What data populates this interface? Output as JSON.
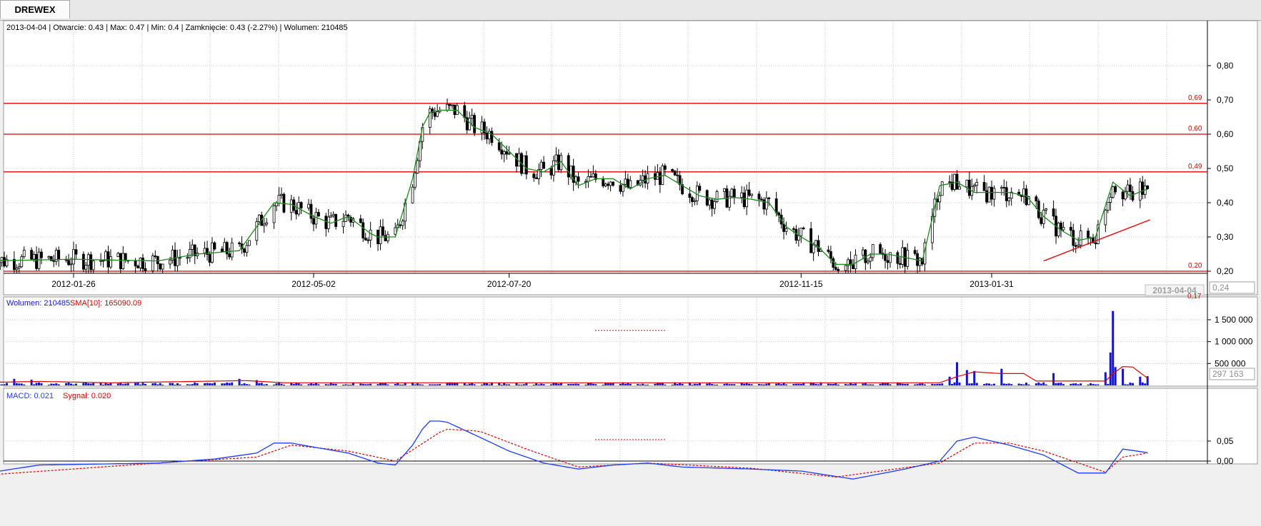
{
  "tab_label": "DREWEX",
  "colors": {
    "sma_line": "#1a8a1a",
    "levels": "#e00000",
    "volume_bars": "#1515d0",
    "volume_sma": "#e00000",
    "macd": "#1e3cff",
    "signal": "#e00000"
  },
  "chart_data": [
    {
      "type": "candlestick",
      "info_line": "2013-04-04 | Otwarcie: 0.43 | Max: 0.47 | Min: 0.4 | Zamknięcie: 0.43 (-2.27%) | Wolumen: 210485",
      "x_ticks": [
        "2012-01-26",
        "2012-05-02",
        "2012-07-20",
        "2012-11-15",
        "2013-01-31"
      ],
      "current_date_label": "2013-04-04",
      "y_ticks": [
        "0,20",
        "0,30",
        "0,40",
        "0,50",
        "0,60",
        "0,70",
        "0,80"
      ],
      "ylim": [
        0.19,
        0.85
      ],
      "horizontal_levels": [
        {
          "value": 0.69,
          "label": "0,69"
        },
        {
          "value": 0.6,
          "label": "0,60"
        },
        {
          "value": 0.49,
          "label": "0,49"
        },
        {
          "value": 0.2,
          "label": "0,20"
        }
      ],
      "bottom_label": "0,17",
      "last_value_label": "0,24",
      "trend_line": {
        "from": {
          "date": "2013-02-21",
          "value": 0.23
        },
        "to": {
          "date": "2013-04-05",
          "value": 0.35
        }
      },
      "sma_waypoints": [
        {
          "date": "2011-12-22",
          "value": 0.23
        },
        {
          "date": "2012-01-26",
          "value": 0.235
        },
        {
          "date": "2012-02-29",
          "value": 0.23
        },
        {
          "date": "2012-03-16",
          "value": 0.25
        },
        {
          "date": "2012-04-02",
          "value": 0.26
        },
        {
          "date": "2012-04-09",
          "value": 0.33
        },
        {
          "date": "2012-04-16",
          "value": 0.4
        },
        {
          "date": "2012-04-23",
          "value": 0.395
        },
        {
          "date": "2012-05-02",
          "value": 0.36
        },
        {
          "date": "2012-05-09",
          "value": 0.34
        },
        {
          "date": "2012-05-16",
          "value": 0.36
        },
        {
          "date": "2012-05-25",
          "value": 0.31
        },
        {
          "date": "2012-05-28",
          "value": 0.3
        },
        {
          "date": "2012-06-04",
          "value": 0.3
        },
        {
          "date": "2012-06-11",
          "value": 0.47
        },
        {
          "date": "2012-06-16",
          "value": 0.66
        },
        {
          "date": "2012-06-22",
          "value": 0.67
        },
        {
          "date": "2012-06-29",
          "value": 0.67
        },
        {
          "date": "2012-07-06",
          "value": 0.62
        },
        {
          "date": "2012-07-13",
          "value": 0.6
        },
        {
          "date": "2012-07-20",
          "value": 0.55
        },
        {
          "date": "2012-07-27",
          "value": 0.5
        },
        {
          "date": "2012-08-03",
          "value": 0.49
        },
        {
          "date": "2012-08-10",
          "value": 0.52
        },
        {
          "date": "2012-08-17",
          "value": 0.45
        },
        {
          "date": "2012-08-24",
          "value": 0.47
        },
        {
          "date": "2012-08-31",
          "value": 0.47
        },
        {
          "date": "2012-09-07",
          "value": 0.44
        },
        {
          "date": "2012-09-14",
          "value": 0.47
        },
        {
          "date": "2012-09-21",
          "value": 0.48
        },
        {
          "date": "2012-09-28",
          "value": 0.45
        },
        {
          "date": "2012-10-05",
          "value": 0.42
        },
        {
          "date": "2012-10-12",
          "value": 0.41
        },
        {
          "date": "2012-10-19",
          "value": 0.415
        },
        {
          "date": "2012-10-26",
          "value": 0.41
        },
        {
          "date": "2012-11-02",
          "value": 0.4
        },
        {
          "date": "2012-11-09",
          "value": 0.33
        },
        {
          "date": "2012-11-15",
          "value": 0.3
        },
        {
          "date": "2012-11-22",
          "value": 0.27
        },
        {
          "date": "2012-11-29",
          "value": 0.22
        },
        {
          "date": "2012-12-06",
          "value": 0.22
        },
        {
          "date": "2012-12-13",
          "value": 0.25
        },
        {
          "date": "2012-12-20",
          "value": 0.25
        },
        {
          "date": "2012-12-27",
          "value": 0.24
        },
        {
          "date": "2013-01-03",
          "value": 0.23
        },
        {
          "date": "2013-01-10",
          "value": 0.45
        },
        {
          "date": "2013-01-17",
          "value": 0.46
        },
        {
          "date": "2013-01-24",
          "value": 0.43
        },
        {
          "date": "2013-01-31",
          "value": 0.43
        },
        {
          "date": "2013-02-07",
          "value": 0.43
        },
        {
          "date": "2013-02-14",
          "value": 0.42
        },
        {
          "date": "2013-02-21",
          "value": 0.36
        },
        {
          "date": "2013-02-28",
          "value": 0.32
        },
        {
          "date": "2013-03-07",
          "value": 0.29
        },
        {
          "date": "2013-03-14",
          "value": 0.3
        },
        {
          "date": "2013-03-21",
          "value": 0.46
        },
        {
          "date": "2013-03-28",
          "value": 0.42
        },
        {
          "date": "2013-04-04",
          "value": 0.44
        }
      ]
    },
    {
      "type": "bar",
      "title_volume": "Wolumen: 210485",
      "title_sma": "SMA[10]: 165090.09",
      "y_ticks": [
        "500 000",
        "1 000 000",
        "1 500 000"
      ],
      "ylim": [
        0,
        1750000
      ],
      "last_value_label": "297 163",
      "spikes": [
        {
          "date": "2012-01-02",
          "value": 150000
        },
        {
          "date": "2012-01-09",
          "value": 130000
        },
        {
          "date": "2012-04-02",
          "value": 150000
        },
        {
          "date": "2012-04-09",
          "value": 120000
        },
        {
          "date": "2013-01-14",
          "value": 200000
        },
        {
          "date": "2013-01-17",
          "value": 530000
        },
        {
          "date": "2013-01-21",
          "value": 350000
        },
        {
          "date": "2013-01-24",
          "value": 330000
        },
        {
          "date": "2013-02-04",
          "value": 380000
        },
        {
          "date": "2013-02-25",
          "value": 280000
        },
        {
          "date": "2013-03-18",
          "value": 300000
        },
        {
          "date": "2013-03-20",
          "value": 750000
        },
        {
          "date": "2013-03-21",
          "value": 1700000
        },
        {
          "date": "2013-03-22",
          "value": 420000
        },
        {
          "date": "2013-03-25",
          "value": 380000
        },
        {
          "date": "2013-04-01",
          "value": 200000
        },
        {
          "date": "2013-04-04",
          "value": 210485
        }
      ],
      "sma_waypoints": [
        {
          "date": "2011-12-22",
          "value": 70000
        },
        {
          "date": "2012-01-13",
          "value": 90000
        },
        {
          "date": "2012-02-10",
          "value": 60000
        },
        {
          "date": "2012-04-05",
          "value": 110000
        },
        {
          "date": "2012-04-20",
          "value": 60000
        },
        {
          "date": "2013-01-10",
          "value": 60000
        },
        {
          "date": "2013-01-17",
          "value": 200000
        },
        {
          "date": "2013-01-24",
          "value": 310000
        },
        {
          "date": "2013-02-04",
          "value": 270000
        },
        {
          "date": "2013-02-13",
          "value": 270000
        },
        {
          "date": "2013-02-18",
          "value": 100000
        },
        {
          "date": "2013-03-18",
          "value": 100000
        },
        {
          "date": "2013-03-21",
          "value": 270000
        },
        {
          "date": "2013-03-25",
          "value": 430000
        },
        {
          "date": "2013-03-29",
          "value": 420000
        },
        {
          "date": "2013-04-04",
          "value": 165090
        }
      ]
    },
    {
      "type": "line",
      "title_macd": "MACD: 0.021",
      "title_signal": "Sygnał: 0.020",
      "y_ticks": [
        "0,00",
        "0,05"
      ],
      "ylim": [
        -0.05,
        0.11
      ],
      "macd_waypoints": [
        {
          "date": "2011-12-22",
          "value": -0.03
        },
        {
          "date": "2012-01-12",
          "value": -0.01
        },
        {
          "date": "2012-02-29",
          "value": -0.005
        },
        {
          "date": "2012-03-23",
          "value": 0.005
        },
        {
          "date": "2012-04-09",
          "value": 0.02
        },
        {
          "date": "2012-04-16",
          "value": 0.045
        },
        {
          "date": "2012-04-23",
          "value": 0.045
        },
        {
          "date": "2012-05-02",
          "value": 0.035
        },
        {
          "date": "2012-05-16",
          "value": 0.02
        },
        {
          "date": "2012-05-28",
          "value": -0.005
        },
        {
          "date": "2012-06-04",
          "value": -0.01
        },
        {
          "date": "2012-06-11",
          "value": 0.04
        },
        {
          "date": "2012-06-17",
          "value": 0.1
        },
        {
          "date": "2012-06-24",
          "value": 0.1
        },
        {
          "date": "2012-07-01",
          "value": 0.08
        },
        {
          "date": "2012-07-08",
          "value": 0.06
        },
        {
          "date": "2012-07-20",
          "value": 0.025
        },
        {
          "date": "2012-08-03",
          "value": -0.005
        },
        {
          "date": "2012-08-17",
          "value": -0.02
        },
        {
          "date": "2012-08-31",
          "value": -0.01
        },
        {
          "date": "2012-09-14",
          "value": -0.005
        },
        {
          "date": "2012-09-28",
          "value": -0.015
        },
        {
          "date": "2012-10-26",
          "value": -0.02
        },
        {
          "date": "2012-11-15",
          "value": -0.025
        },
        {
          "date": "2012-12-06",
          "value": -0.045
        },
        {
          "date": "2012-12-27",
          "value": -0.02
        },
        {
          "date": "2013-01-10",
          "value": 0.0
        },
        {
          "date": "2013-01-17",
          "value": 0.05
        },
        {
          "date": "2013-01-24",
          "value": 0.06
        },
        {
          "date": "2013-02-07",
          "value": 0.04
        },
        {
          "date": "2013-02-21",
          "value": 0.015
        },
        {
          "date": "2013-03-07",
          "value": -0.03
        },
        {
          "date": "2013-03-18",
          "value": -0.03
        },
        {
          "date": "2013-03-25",
          "value": 0.03
        },
        {
          "date": "2013-04-04",
          "value": 0.021
        }
      ],
      "signal_waypoints": [
        {
          "date": "2011-12-22",
          "value": -0.035
        },
        {
          "date": "2012-02-29",
          "value": -0.005
        },
        {
          "date": "2012-04-09",
          "value": 0.01
        },
        {
          "date": "2012-04-23",
          "value": 0.04
        },
        {
          "date": "2012-05-16",
          "value": 0.025
        },
        {
          "date": "2012-06-04",
          "value": 0.0
        },
        {
          "date": "2012-06-24",
          "value": 0.08
        },
        {
          "date": "2012-07-08",
          "value": 0.075
        },
        {
          "date": "2012-07-27",
          "value": 0.03
        },
        {
          "date": "2012-08-17",
          "value": -0.015
        },
        {
          "date": "2012-09-14",
          "value": -0.005
        },
        {
          "date": "2012-10-26",
          "value": -0.018
        },
        {
          "date": "2012-11-29",
          "value": -0.04
        },
        {
          "date": "2013-01-10",
          "value": -0.005
        },
        {
          "date": "2013-01-24",
          "value": 0.045
        },
        {
          "date": "2013-02-07",
          "value": 0.045
        },
        {
          "date": "2013-02-21",
          "value": 0.025
        },
        {
          "date": "2013-03-18",
          "value": -0.028
        },
        {
          "date": "2013-03-25",
          "value": 0.01
        },
        {
          "date": "2013-04-04",
          "value": 0.02
        }
      ]
    }
  ]
}
